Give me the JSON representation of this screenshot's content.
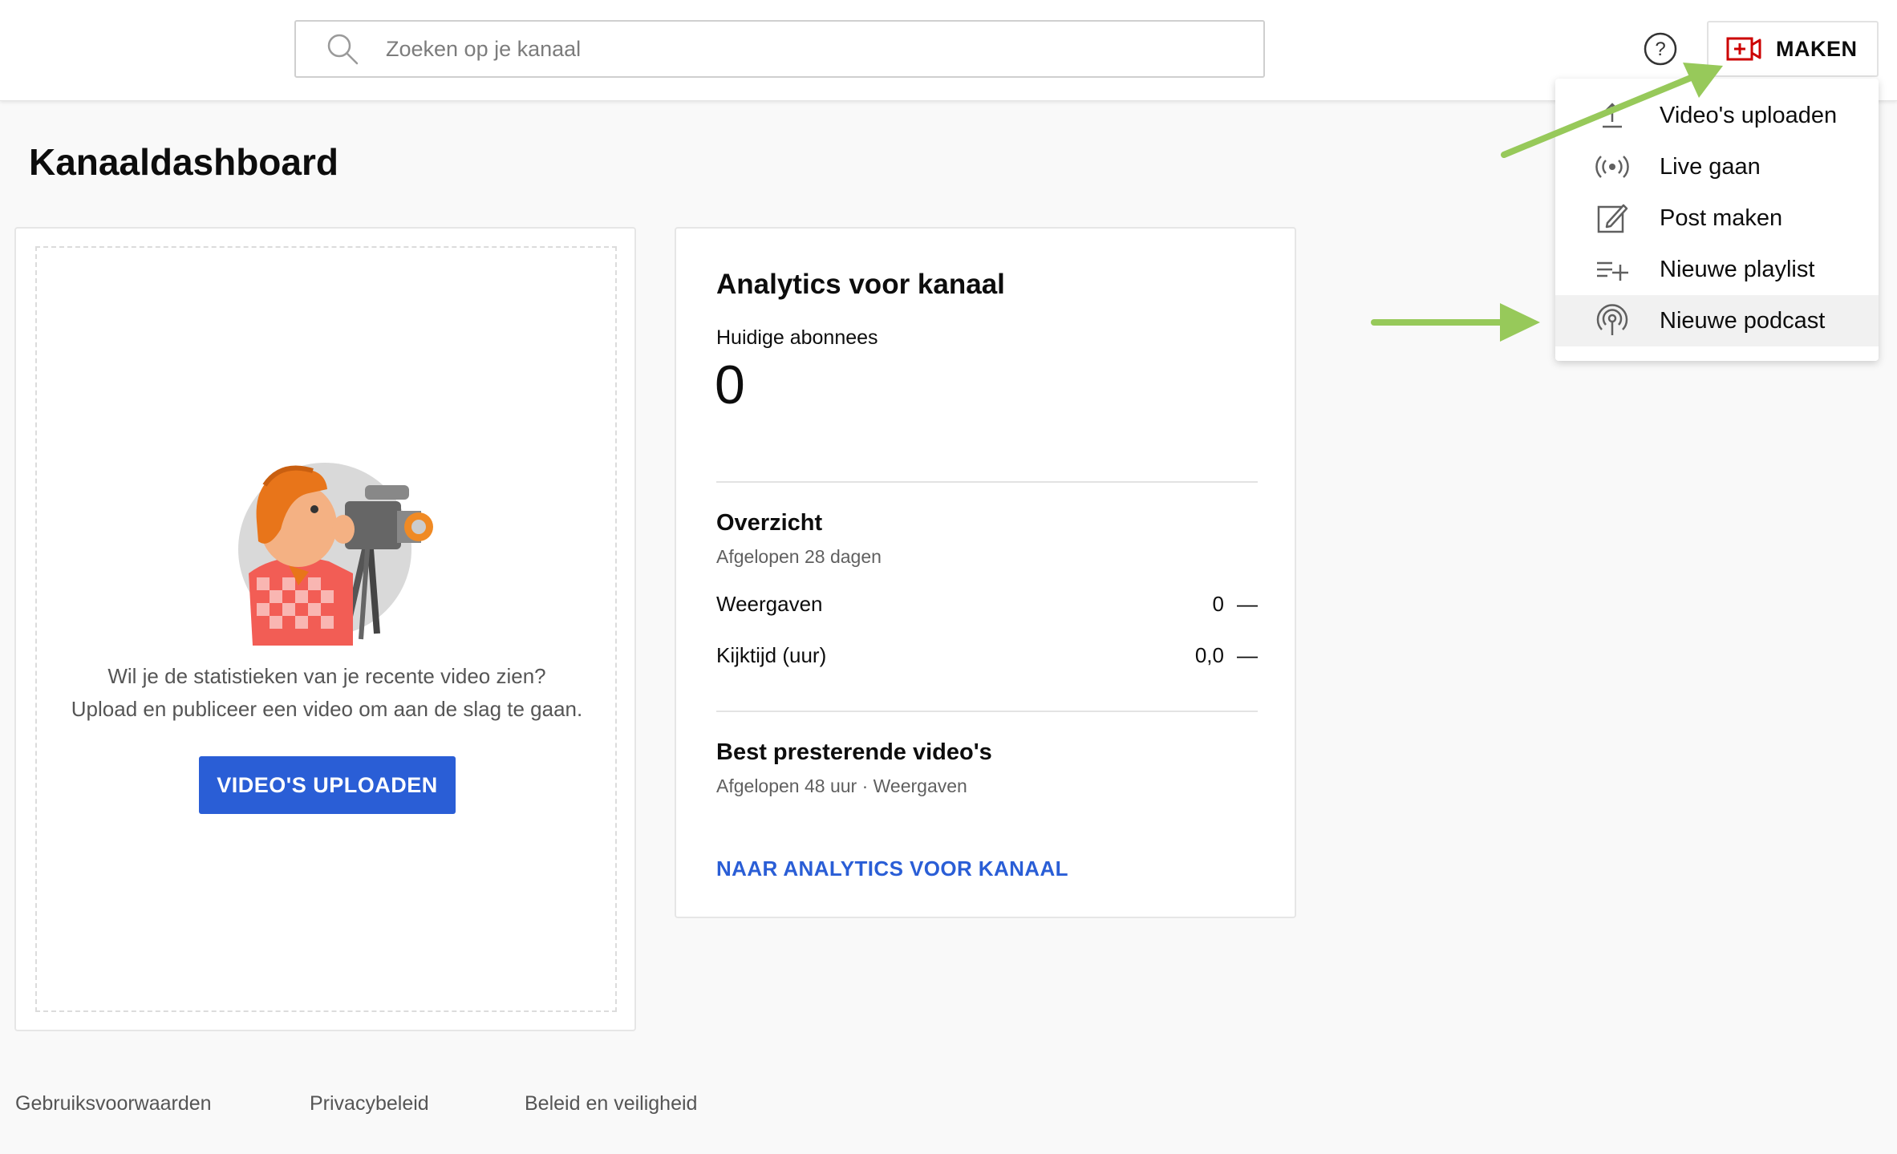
{
  "header": {
    "search_placeholder": "Zoeken op je kanaal",
    "create_label": "MAKEN"
  },
  "page_title": "Kanaaldashboard",
  "upload_card": {
    "line1": "Wil je de statistieken van je recente video zien?",
    "line2": "Upload en publiceer een video om aan de slag te gaan.",
    "button_label": "VIDEO'S UPLOADEN"
  },
  "analytics_card": {
    "title": "Analytics voor kanaal",
    "subscribers_label": "Huidige abonnees",
    "subscribers_value": "0",
    "overview_title": "Overzicht",
    "overview_period": "Afgelopen 28 dagen",
    "rows": [
      {
        "label": "Weergaven",
        "value": "0",
        "trend": "—"
      },
      {
        "label": "Kijktijd (uur)",
        "value": "0,0",
        "trend": "—"
      }
    ],
    "top_videos_title": "Best presterende video's",
    "top_videos_period": "Afgelopen 48 uur · Weergaven",
    "link_label": "NAAR ANALYTICS VOOR KANAAL"
  },
  "create_menu": {
    "items": [
      {
        "label": "Video's uploaden",
        "icon": "upload-icon"
      },
      {
        "label": "Live gaan",
        "icon": "live-icon"
      },
      {
        "label": "Post maken",
        "icon": "edit-post-icon"
      },
      {
        "label": "Nieuwe playlist",
        "icon": "playlist-add-icon"
      },
      {
        "label": "Nieuwe podcast",
        "icon": "podcast-icon"
      }
    ]
  },
  "footer": {
    "links": [
      "Gebruiksvoorwaarden",
      "Privacybeleid",
      "Beleid en veiligheid"
    ]
  },
  "colors": {
    "accent_blue": "#2a5ed6",
    "brand_red": "#cc0000",
    "annotation_arrow": "#97c95a"
  }
}
